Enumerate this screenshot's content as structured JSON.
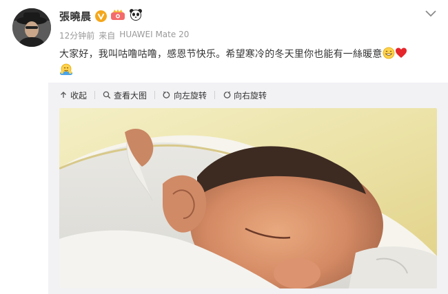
{
  "post": {
    "author": "張曉晨",
    "time": "12分钟前",
    "source_prefix": "来自",
    "source_device": "HUAWEI Mate 20",
    "text": "大家好，我叫咕噜咕噜，感恩节快乐。希望寒冷的冬天里你也能有一絲暖意",
    "text_emojis": [
      "grin-emoji",
      "red-heart-emoji"
    ],
    "second_line_emoji": "hug-emoji"
  },
  "badges": {
    "verified": "verified-v-icon",
    "member": "crown-member-icon",
    "panda": "panda-icon"
  },
  "toolbar": {
    "collapse": "收起",
    "view_large": "查看大图",
    "rotate_left": "向左旋转",
    "rotate_right": "向右旋转"
  },
  "colors": {
    "author_text": "#333333",
    "meta_text": "#999999",
    "verified_badge": "#f4a71b",
    "panel_bg": "#f2f2f5"
  },
  "photo": {
    "subject": "sleeping newborn under a yellow blanket"
  }
}
